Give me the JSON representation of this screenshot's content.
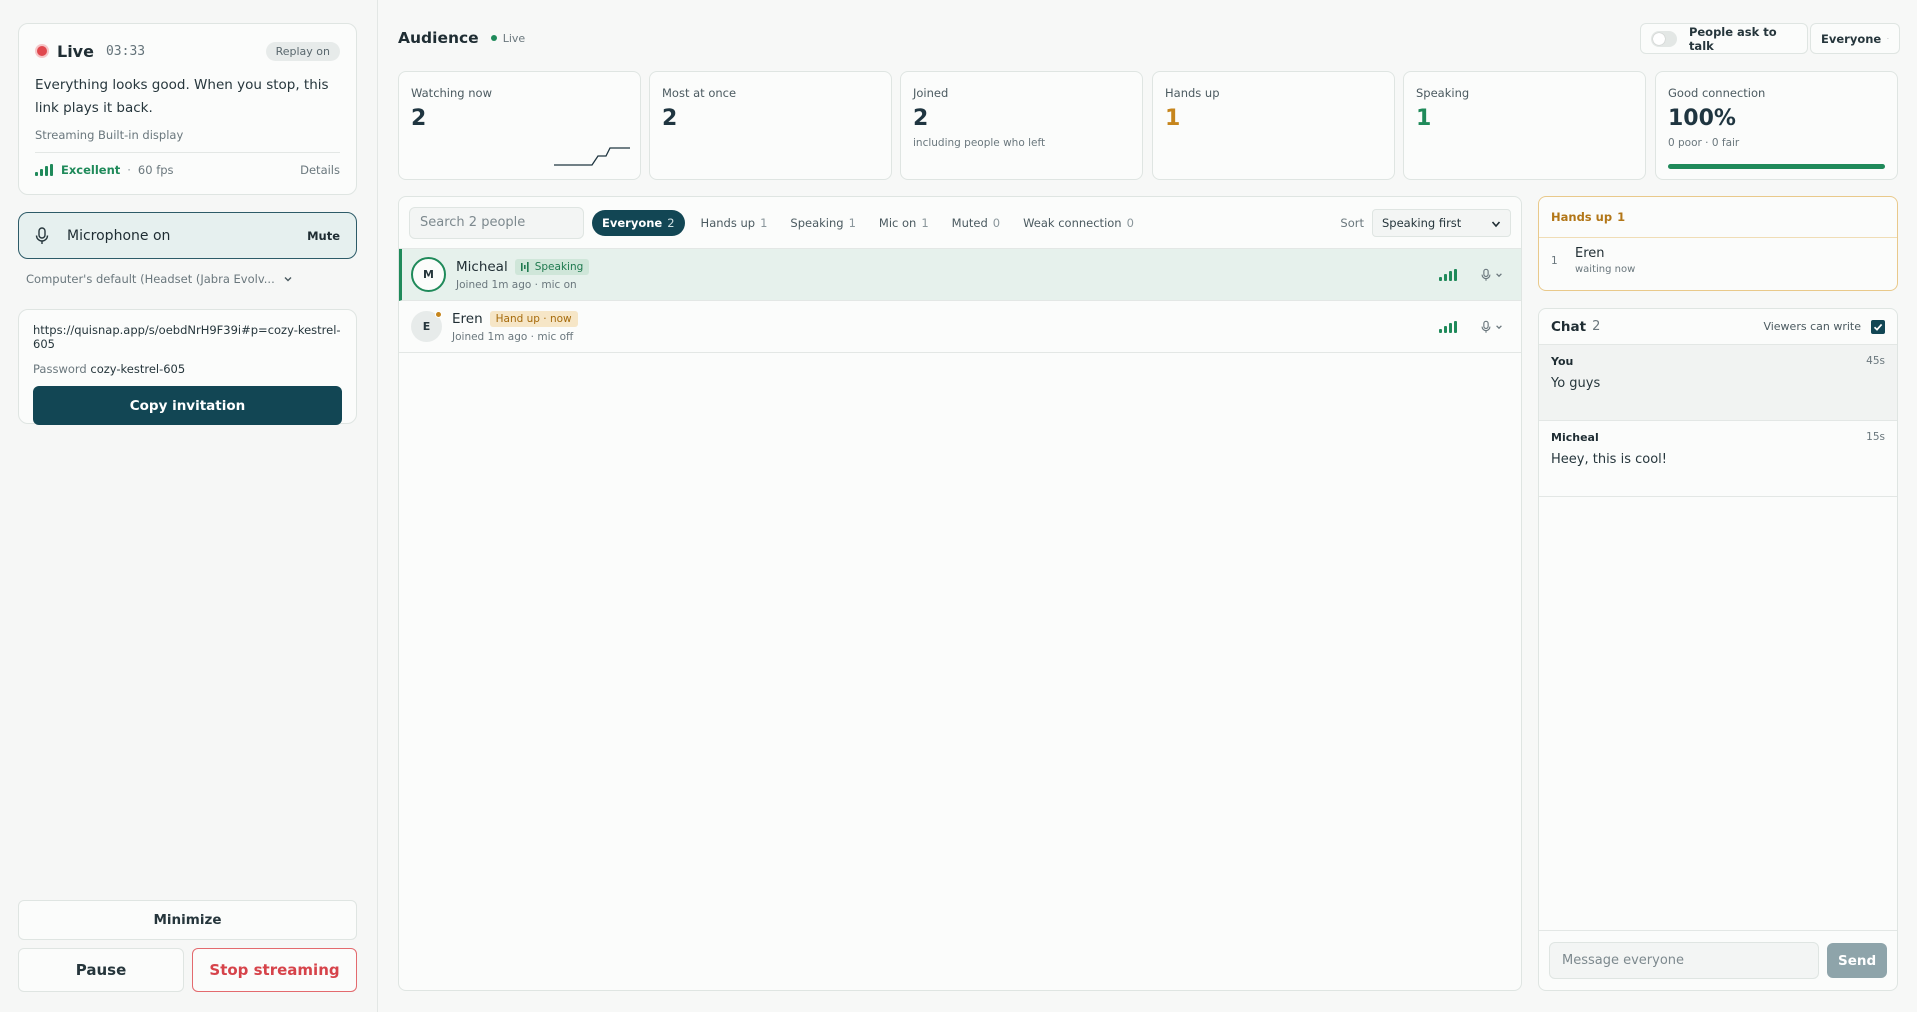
{
  "live": {
    "label": "Live",
    "time": "03:33",
    "replay": "Replay on",
    "message": "Everything looks good. When you stop, this link plays it back.",
    "source": "Streaming Built-in display",
    "quality": "Excellent",
    "separator": "·",
    "fps": "60 fps",
    "details": "Details"
  },
  "mic": {
    "label": "Microphone on",
    "mute": "Mute",
    "device": "Computer's default (Headset (Jabra Evolv..."
  },
  "invite": {
    "url": "https://quisnap.app/s/oebdNrH9F39i#p=cozy-kestrel-605",
    "password_label": "Password",
    "password": "cozy-kestrel-605",
    "copy": "Copy invitation"
  },
  "controls": {
    "minimize": "Minimize",
    "pause": "Pause",
    "stop": "Stop streaming"
  },
  "audience": {
    "title": "Audience",
    "live": "Live",
    "ask_to_talk": "People ask to talk",
    "scope": "Everyone"
  },
  "stats": [
    {
      "label": "Watching now",
      "value": "2",
      "sub": ""
    },
    {
      "label": "Most at once",
      "value": "2",
      "sub": ""
    },
    {
      "label": "Joined",
      "value": "2",
      "sub": "including people who left"
    },
    {
      "label": "Hands up",
      "value": "1",
      "sub": ""
    },
    {
      "label": "Speaking",
      "value": "1",
      "sub": ""
    },
    {
      "label": "Good connection",
      "value": "100%",
      "sub": "0 poor · 0 fair",
      "bar_fraction": 1.0
    }
  ],
  "people": {
    "search_placeholder": "Search 2 people",
    "filters": [
      {
        "label": "Everyone",
        "count": "2"
      },
      {
        "label": "Hands up",
        "count": "1"
      },
      {
        "label": "Speaking",
        "count": "1"
      },
      {
        "label": "Mic on",
        "count": "1"
      },
      {
        "label": "Muted",
        "count": "0"
      },
      {
        "label": "Weak connection",
        "count": "0"
      }
    ],
    "sort_label": "Sort",
    "sort_value": "Speaking first",
    "rows": [
      {
        "initial": "M",
        "name": "Micheal",
        "badge": "Speaking",
        "sub": "Joined 1m ago · mic on"
      },
      {
        "initial": "E",
        "name": "Eren",
        "badge": "Hand up · now",
        "sub": "Joined 1m ago · mic off"
      }
    ]
  },
  "hands": {
    "title": "Hands up",
    "count": "1",
    "items": [
      {
        "num": "1",
        "name": "Eren",
        "sub": "waiting now"
      }
    ]
  },
  "chat": {
    "title": "Chat",
    "count": "2",
    "viewers_write": "Viewers can write",
    "messages": [
      {
        "author": "You",
        "time": "45s",
        "text": "Yo guys"
      },
      {
        "author": "Micheal",
        "time": "15s",
        "text": "Heey, this is cool!"
      }
    ],
    "input_placeholder": "Message everyone",
    "send": "Send"
  },
  "colors": {
    "accent": "#124654",
    "live_red": "#e0484e",
    "success": "#1f8a5a",
    "amber": "#c6851c"
  }
}
